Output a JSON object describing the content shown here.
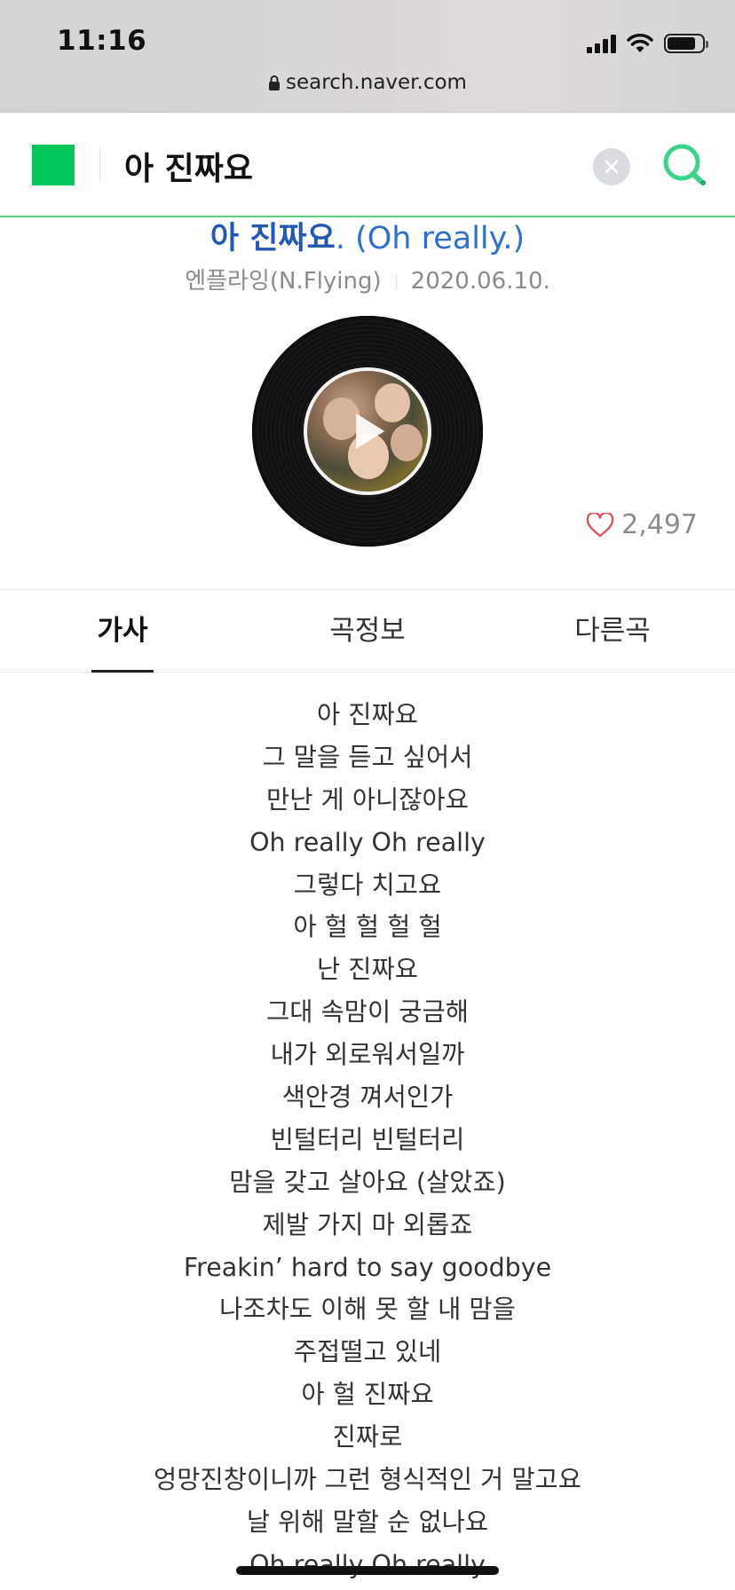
{
  "status_bar": {
    "time": "11:16"
  },
  "browser": {
    "url": "search.naver.com"
  },
  "search": {
    "query": "아 진짜요"
  },
  "song": {
    "title_kr": "아 진짜요",
    "title_en": ". (Oh really.)",
    "artist": "엔플라잉(N.Flying)",
    "date": "2020.06.10.",
    "likes": "2,497"
  },
  "tabs": [
    {
      "label": "가사",
      "active": true
    },
    {
      "label": "곡정보",
      "active": false
    },
    {
      "label": "다른곡",
      "active": false
    }
  ],
  "lyrics": [
    "아 진짜요",
    "그 말을 듣고 싶어서",
    "만난 게 아니잖아요",
    "Oh really Oh really",
    "그렇다 치고요",
    "아 헐 헐 헐 헐",
    "난 진짜요",
    "그대 속맘이 궁금해",
    "내가 외로워서일까",
    "색안경 껴서인가",
    "빈털터리 빈털터리",
    "맘을 갖고 살아요 (살았죠)",
    "제발 가지 마 외롭죠",
    "Freakin’ hard to say goodbye",
    "나조차도 이해 못 할 내 맘을",
    "주접떨고 있네",
    "아 헐 진짜요",
    "진짜로",
    "엉망진창이니까 그런 형식적인 거 말고요",
    "날 위해 말할 순 없나요",
    "Oh really Oh really"
  ],
  "colors": {
    "naver_green": "#03c75a",
    "title_blue": "#2458b5",
    "heart_red": "#e0525a"
  }
}
